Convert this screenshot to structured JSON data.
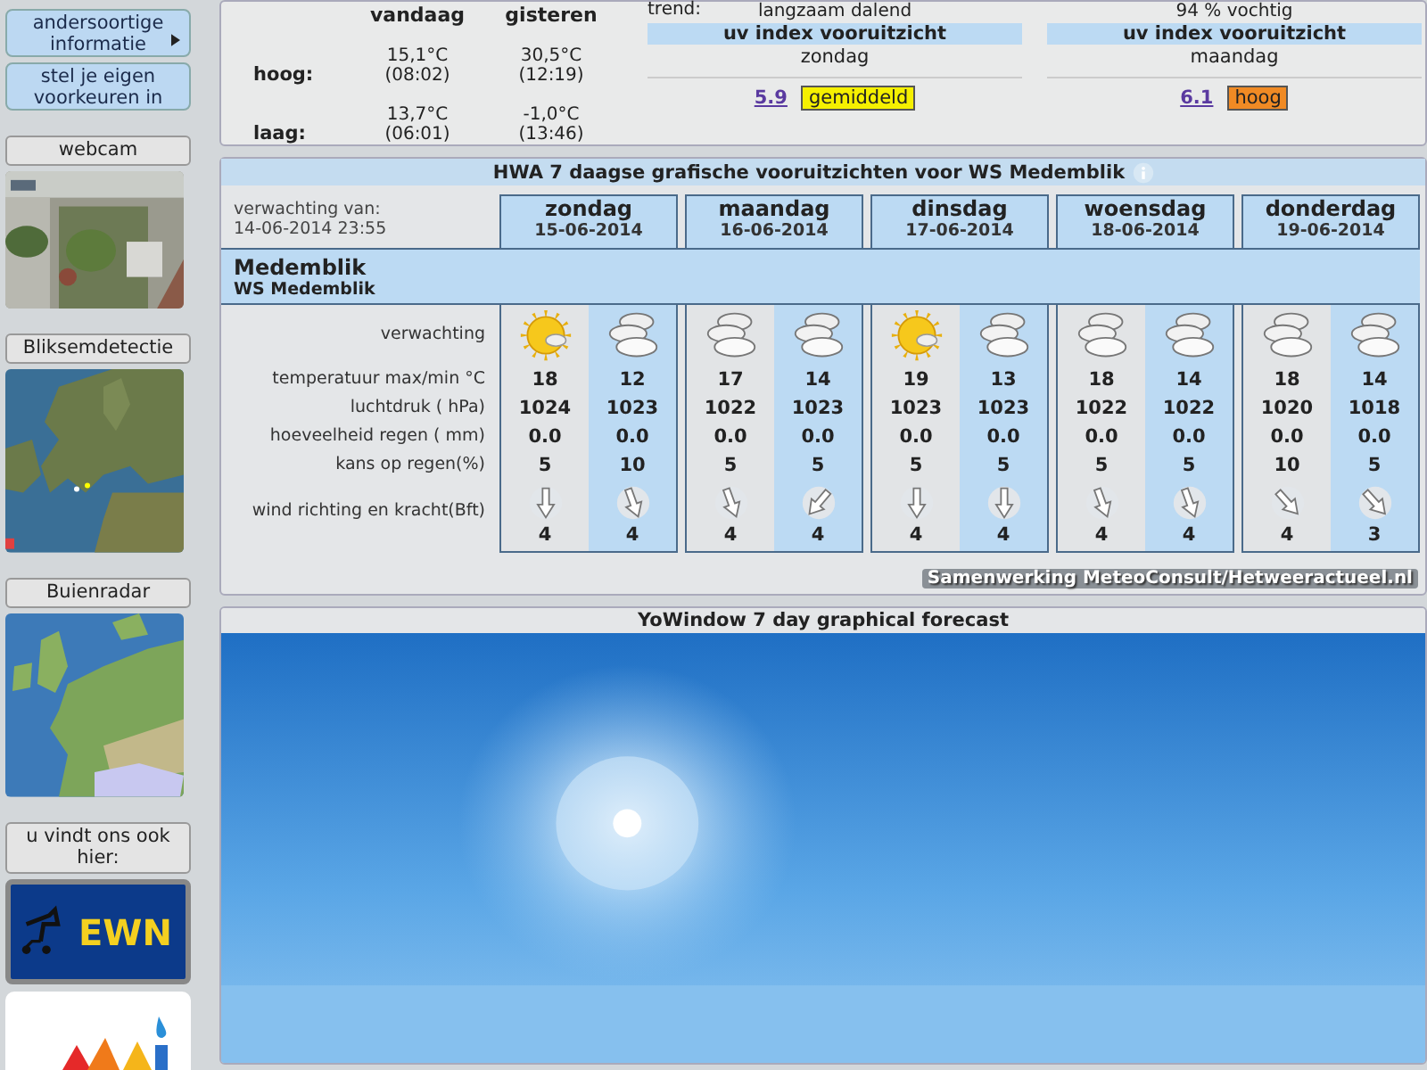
{
  "sidebar": {
    "menu": [
      {
        "label": "andersoortige informatie",
        "submenu": true
      },
      {
        "label": "stel je eigen voorkeuren in",
        "submenu": false
      }
    ],
    "sections": [
      {
        "title": "webcam",
        "kind": "webcam"
      },
      {
        "title": "Bliksemdetectie",
        "kind": "lightning"
      },
      {
        "title": "Buienradar",
        "kind": "radar"
      },
      {
        "title": "u vindt ons ook hier:",
        "kind": "links"
      }
    ],
    "ewn_logo": "EWN"
  },
  "current": {
    "headers": [
      "vandaag",
      "gisteren"
    ],
    "rows": [
      {
        "label": "hoog:",
        "values": [
          {
            "temp": "15,1°C",
            "time": "(08:02)"
          },
          {
            "temp": "30,5°C",
            "time": "(12:19)"
          }
        ]
      },
      {
        "label": "laag:",
        "values": [
          {
            "temp": "13,7°C",
            "time": "(06:01)"
          },
          {
            "temp": "-1,0°C",
            "time": "(13:46)"
          }
        ]
      }
    ],
    "trend_label": "trend:",
    "uv": [
      {
        "top": "langzaam dalend",
        "title": "uv index vooruitzicht",
        "day": "zondag",
        "value": "5.9",
        "level_text": "gemiddeld",
        "color": "#f5f000"
      },
      {
        "top": "94 % vochtig",
        "title": "uv index vooruitzicht",
        "day": "maandag",
        "value": "6.1",
        "level_text": "hoog",
        "color": "#f08a24"
      }
    ]
  },
  "forecast": {
    "title": "HWA 7 daagse grafische vooruitzichten voor WS Medemblik",
    "issued_label": "verwachting van:",
    "issued": "14-06-2014 23:55",
    "place": "Medemblik",
    "station": "WS Medemblik",
    "row_labels": [
      "verwachting",
      "temperatuur max/min °C",
      "luchtdruk ( hPa)",
      "hoeveelheid regen ( mm)",
      "kans op regen(%)",
      "wind richting en kracht(Bft)"
    ],
    "days": [
      {
        "name": "zondag",
        "date": "15-06-2014",
        "periods": [
          {
            "kind": "sun-cloud",
            "temp": "18",
            "pressure": "1024",
            "rain": "0.0",
            "chance": "5",
            "wind": {
              "kind": "N",
              "force": "4"
            }
          },
          {
            "kind": "cloudy",
            "temp": "12",
            "pressure": "1023",
            "rain": "0.0",
            "chance": "10",
            "wind": {
              "kind": "NNW",
              "force": "4"
            }
          }
        ]
      },
      {
        "name": "maandag",
        "date": "16-06-2014",
        "periods": [
          {
            "kind": "cloudy",
            "temp": "17",
            "pressure": "1022",
            "rain": "0.0",
            "chance": "5",
            "wind": {
              "kind": "NNW",
              "force": "4"
            }
          },
          {
            "kind": "cloudy",
            "temp": "14",
            "pressure": "1023",
            "rain": "0.0",
            "chance": "5",
            "wind": {
              "kind": "NE",
              "force": "4"
            }
          }
        ]
      },
      {
        "name": "dinsdag",
        "date": "17-06-2014",
        "periods": [
          {
            "kind": "sun-cloud",
            "temp": "19",
            "pressure": "1023",
            "rain": "0.0",
            "chance": "5",
            "wind": {
              "kind": "N",
              "force": "4"
            }
          },
          {
            "kind": "cloudy",
            "temp": "13",
            "pressure": "1023",
            "rain": "0.0",
            "chance": "5",
            "wind": {
              "kind": "N",
              "force": "4"
            }
          }
        ]
      },
      {
        "name": "woensdag",
        "date": "18-06-2014",
        "periods": [
          {
            "kind": "cloudy",
            "temp": "18",
            "pressure": "1022",
            "rain": "0.0",
            "chance": "5",
            "wind": {
              "kind": "NNW",
              "force": "4"
            }
          },
          {
            "kind": "cloudy",
            "temp": "14",
            "pressure": "1022",
            "rain": "0.0",
            "chance": "5",
            "wind": {
              "kind": "NNW",
              "force": "4"
            }
          }
        ]
      },
      {
        "name": "donderdag",
        "date": "19-06-2014",
        "periods": [
          {
            "kind": "cloudy",
            "temp": "18",
            "pressure": "1020",
            "rain": "0.0",
            "chance": "10",
            "wind": {
              "kind": "NW",
              "force": "4"
            }
          },
          {
            "kind": "cloudy",
            "temp": "14",
            "pressure": "1018",
            "rain": "0.0",
            "chance": "5",
            "wind": {
              "kind": "NW",
              "force": "3"
            }
          }
        ]
      }
    ],
    "credit": "Samenwerking MeteoConsult/Hetweeractueel.nl"
  },
  "yowindow": {
    "title": "YoWindow 7 day graphical forecast"
  }
}
